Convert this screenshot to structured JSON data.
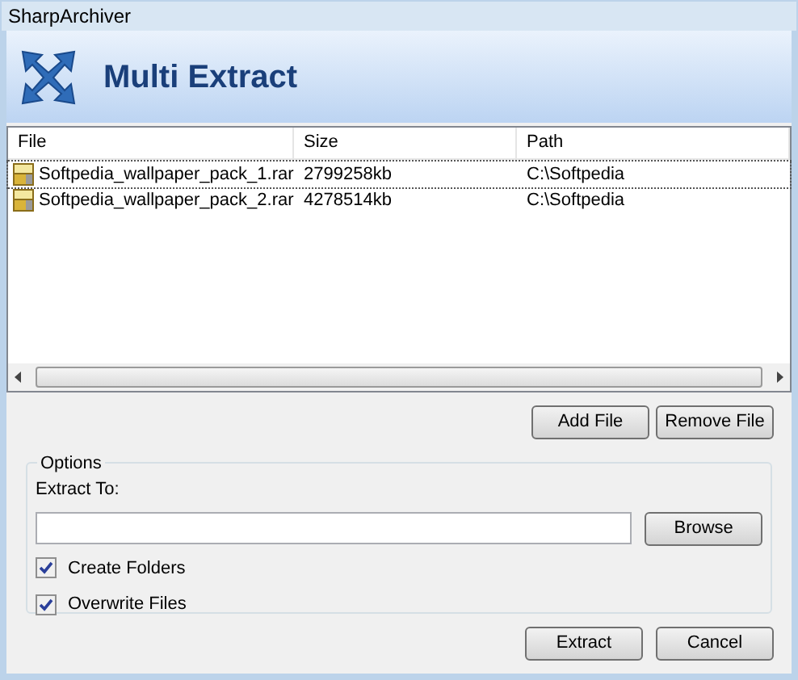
{
  "window": {
    "title": "SharpArchiver"
  },
  "header": {
    "title": "Multi Extract"
  },
  "table": {
    "columns": [
      "File",
      "Size",
      "Path"
    ],
    "rows": [
      {
        "file": "Softpedia_wallpaper_pack_1.rar",
        "size": "2799258kb",
        "path": "C:\\Softpedia",
        "focused": true
      },
      {
        "file": "Softpedia_wallpaper_pack_2.rar",
        "size": "4278514kb",
        "path": "C:\\Softpedia",
        "focused": false
      }
    ]
  },
  "list_buttons": [
    "Add File",
    "Remove File"
  ],
  "options": {
    "title": "Options",
    "extract_to_label": "Extract To:",
    "browse": "Browse",
    "checkboxes": [
      {
        "label": "Create Folders",
        "checked": true
      },
      {
        "label": "Overwrite Files",
        "checked": true
      }
    ]
  },
  "buttons": [
    "Extract",
    "Cancel"
  ]
}
